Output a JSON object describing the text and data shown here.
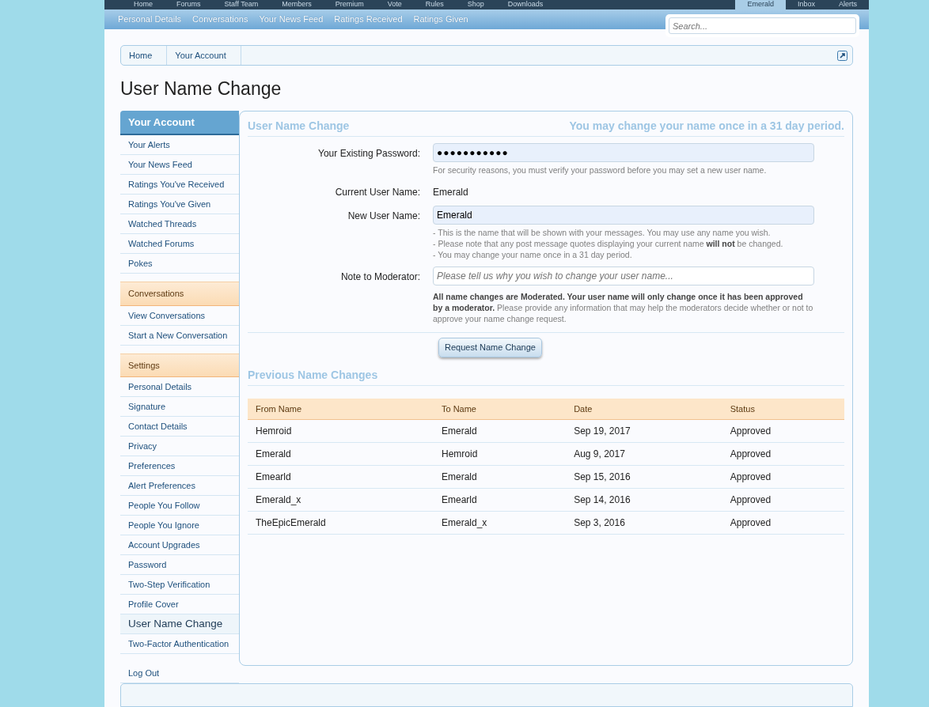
{
  "top_nav": {
    "tabs": [
      {
        "label": "Home",
        "selected": false
      },
      {
        "label": "Forums",
        "selected": false
      },
      {
        "label": "Staff Team",
        "selected": false
      },
      {
        "label": "Members",
        "selected": false
      },
      {
        "label": "Premium",
        "selected": false
      },
      {
        "label": "Vote",
        "selected": false
      },
      {
        "label": "Rules",
        "selected": false
      },
      {
        "label": "Shop",
        "selected": false
      },
      {
        "label": "Downloads",
        "selected": false
      }
    ],
    "user_tabs": [
      {
        "label": "Emerald",
        "selected": true
      },
      {
        "label": "Inbox",
        "selected": false
      },
      {
        "label": "Alerts",
        "selected": false
      }
    ]
  },
  "sub_nav": [
    "Personal Details",
    "Conversations",
    "Your News Feed",
    "Ratings Received",
    "Ratings Given"
  ],
  "search": {
    "placeholder": "Search..."
  },
  "breadcrumb": [
    "Home",
    "Your Account"
  ],
  "page_title": "User Name Change",
  "sidebar": [
    {
      "kind": "primary",
      "title": "Your Account",
      "items": [
        {
          "label": "Your Alerts",
          "selected": false
        },
        {
          "label": "Your News Feed",
          "selected": false
        },
        {
          "label": "Ratings You've Received",
          "selected": false
        },
        {
          "label": "Ratings You've Given",
          "selected": false
        },
        {
          "label": "Watched Threads",
          "selected": false
        },
        {
          "label": "Watched Forums",
          "selected": false
        },
        {
          "label": "Pokes",
          "selected": false
        }
      ]
    },
    {
      "kind": "secondary",
      "title": "Conversations",
      "items": [
        {
          "label": "View Conversations",
          "selected": false
        },
        {
          "label": "Start a New Conversation",
          "selected": false
        }
      ]
    },
    {
      "kind": "secondary",
      "title": "Settings",
      "items": [
        {
          "label": "Personal Details",
          "selected": false
        },
        {
          "label": "Signature",
          "selected": false
        },
        {
          "label": "Contact Details",
          "selected": false
        },
        {
          "label": "Privacy",
          "selected": false
        },
        {
          "label": "Preferences",
          "selected": false
        },
        {
          "label": "Alert Preferences",
          "selected": false
        },
        {
          "label": "People You Follow",
          "selected": false
        },
        {
          "label": "People You Ignore",
          "selected": false
        },
        {
          "label": "Account Upgrades",
          "selected": false
        },
        {
          "label": "Password",
          "selected": false
        },
        {
          "label": "Two-Step Verification",
          "selected": false
        },
        {
          "label": "Profile Cover",
          "selected": false
        },
        {
          "label": "User Name Change",
          "selected": true
        },
        {
          "label": "Two-Factor Authentication",
          "selected": false
        }
      ]
    },
    {
      "kind": "plain",
      "items": [
        {
          "label": "Log Out",
          "selected": false
        }
      ]
    }
  ],
  "form": {
    "heading": "User Name Change",
    "heading_note": "You may change your name once in a 31 day period.",
    "fields": [
      {
        "kind": "password",
        "label": "Your Existing Password:",
        "value": "●●●●●●●●●●●",
        "notes": [
          "For security reasons, you must verify your password before you may set a new user name."
        ]
      },
      {
        "kind": "static",
        "label": "Current User Name:",
        "value": "Emerald"
      },
      {
        "kind": "text",
        "label": "New User Name:",
        "value": "Emerald",
        "notes": [
          "- This is the name that will be shown with your messages. You may use any name you wish.",
          "- Please note that any post message quotes displaying your current name **will not** be changed.",
          "- You may change your name once in a 31 day period."
        ]
      },
      {
        "kind": "textarea",
        "label": "Note to Moderator:",
        "placeholder": "Please tell us why you wish to change your user name...",
        "notes": [
          "**All name changes are Moderated. Your user name will only change once it has been approved by a moderator.** Please provide any information that may help the moderators decide whether or not to approve your name change request."
        ]
      }
    ],
    "button": "Request Name Change"
  },
  "history": {
    "heading": "Previous Name Changes",
    "columns": [
      "From Name",
      "To Name",
      "Date",
      "Status"
    ],
    "rows": [
      [
        "Hemroid",
        "Emerald",
        "Sep 19, 2017",
        "Approved"
      ],
      [
        "Emerald",
        "Hemroid",
        "Aug 9, 2017",
        "Approved"
      ],
      [
        "Emearld",
        "Emerald",
        "Sep 15, 2016",
        "Approved"
      ],
      [
        "Emerald_x",
        "Emearld",
        "Sep 14, 2016",
        "Approved"
      ],
      [
        "TheEpicEmerald",
        "Emerald_x",
        "Sep 3, 2016",
        "Approved"
      ]
    ]
  }
}
